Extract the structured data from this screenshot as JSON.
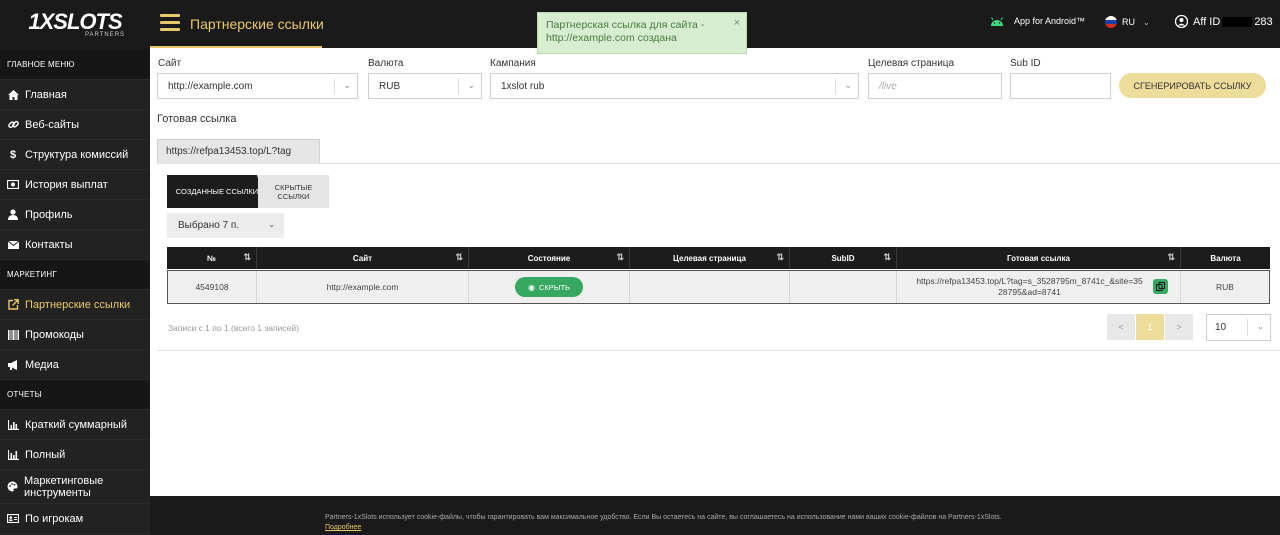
{
  "brand": {
    "logo": "1XSLOTS",
    "sub": "PARTNERS"
  },
  "sidebar": {
    "sections": {
      "main": "ГЛАВНОЕ МЕНЮ",
      "marketing": "МАРКЕТИНГ",
      "reports": "ОТЧЕТЫ"
    },
    "items": [
      {
        "label": "Главная",
        "icon": "home-icon"
      },
      {
        "label": "Веб-сайты",
        "icon": "link-icon"
      },
      {
        "label": "Структура комиссий",
        "icon": "dollar-icon"
      },
      {
        "label": "История выплат",
        "icon": "cash-icon"
      },
      {
        "label": "Профиль",
        "icon": "user-icon"
      },
      {
        "label": "Контакты",
        "icon": "envelope-icon"
      },
      {
        "label": "Партнерские ссылки",
        "icon": "external-link-icon"
      },
      {
        "label": "Промокоды",
        "icon": "barcode-icon"
      },
      {
        "label": "Медиа",
        "icon": "megaphone-icon"
      },
      {
        "label": "Краткий суммарный",
        "icon": "bar-chart-icon"
      },
      {
        "label": "Полный",
        "icon": "bar-chart-icon"
      },
      {
        "label": "Маркетинговые инструменты",
        "icon": "palette-icon"
      },
      {
        "label": "По игрокам",
        "icon": "id-card-icon"
      }
    ]
  },
  "header": {
    "title": "Партнерские ссылки",
    "android": "App for Android™",
    "lang": "RU",
    "aff_prefix": "Aff ID",
    "aff_suffix": "283"
  },
  "toast": {
    "text": "Партнерская ссылка для сайта - http://example.com создана",
    "close": "×"
  },
  "form": {
    "site_label": "Сайт",
    "site_value": "http://example.com",
    "currency_label": "Валюта",
    "currency_value": "RUB",
    "campaign_label": "Кампания",
    "campaign_value": "1xslot rub",
    "target_label": "Целевая страница",
    "target_placeholder": "/live",
    "subid_label": "Sub ID",
    "subid_value": "",
    "generate": "Сгенерировать ссылку"
  },
  "ready": {
    "label": "Готовая ссылка",
    "value": "https://refpa13453.top/L?tag"
  },
  "tabs": {
    "created": "Созданные ссылки",
    "hidden": "Скрытые ссылки"
  },
  "selected": "Выбрано 7 п.",
  "table": {
    "headers": [
      "№",
      "Сайт",
      "Состояние",
      "Целевая страница",
      "SubID",
      "Готовая ссылка",
      "Валюта"
    ],
    "row": {
      "id": "4549108",
      "site": "http://example.com",
      "state": "Скрыть",
      "target": "",
      "subid": "",
      "link": "https://refpa13453.top/L?tag=s_3528795m_8741c_&site=3528795&ad=8741",
      "currency": "RUB"
    }
  },
  "pagination": {
    "records": "Записи с 1 по 1 (всего 1 записей)",
    "prev": "<",
    "page": "1",
    "next": ">",
    "per_page": "10"
  },
  "footer": {
    "cookie": "Partners-1xSlots использует cookie-файлы, чтобы гарантировать вам максимальное удобство. Если Вы остаетесь на сайте, вы соглашаетесь на использование нами ваших cookie-файлов на Partners-1xSlots.",
    "more": "Подробнее"
  },
  "colors": {
    "accent": "#e8c96a",
    "dark": "#1c1c1c",
    "green": "#37a861",
    "toast_bg": "#d6edcf"
  }
}
